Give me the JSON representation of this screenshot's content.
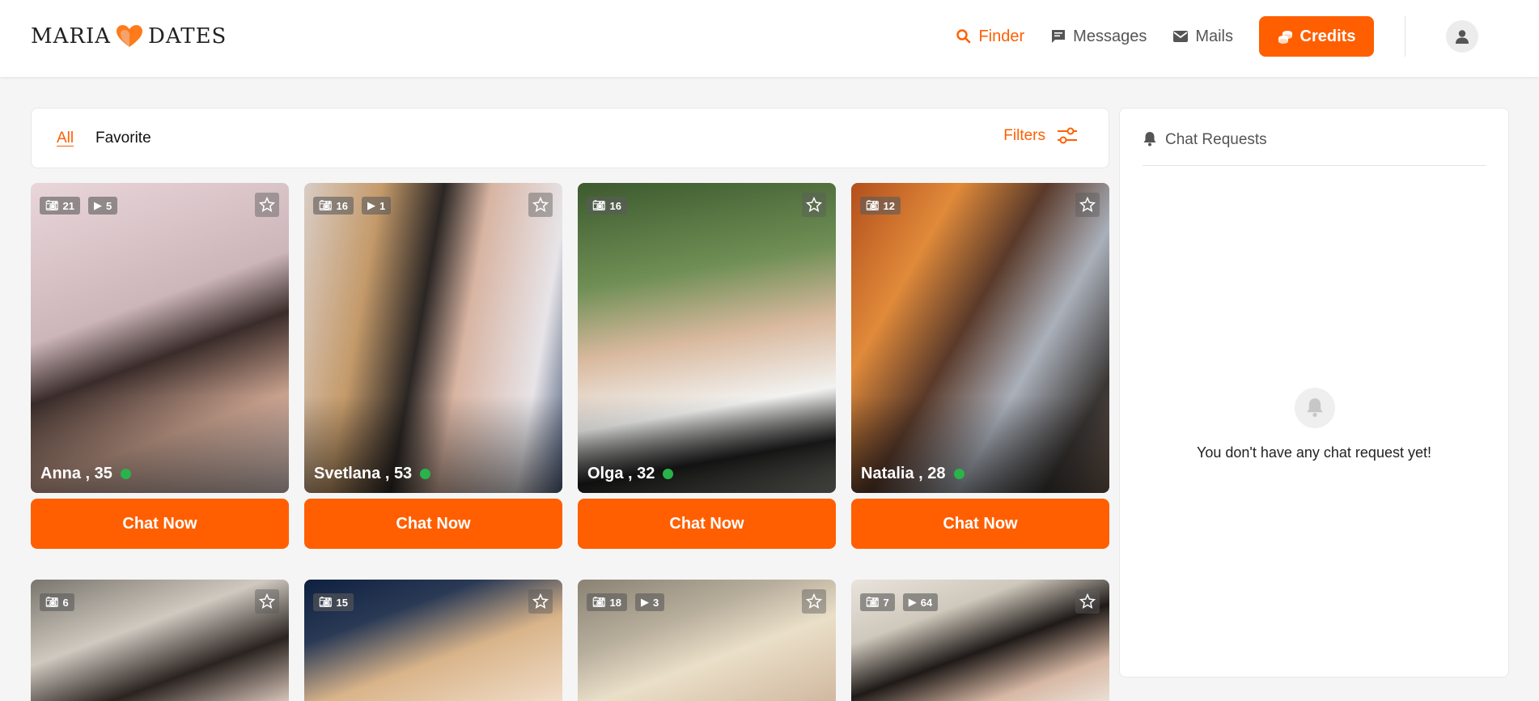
{
  "brand": {
    "left": "MARIA",
    "right": "DATES",
    "accent": "#ff5f00"
  },
  "nav": {
    "finder": "Finder",
    "messages": "Messages",
    "mails": "Mails",
    "credits": "Credits"
  },
  "tabs": {
    "all": "All",
    "favorite": "Favorite",
    "filters": "Filters"
  },
  "cards": [
    {
      "name": "Anna",
      "age": "35",
      "photos": "21",
      "videos": "5",
      "online": true,
      "cta": "Chat Now"
    },
    {
      "name": "Svetlana",
      "age": "53",
      "photos": "16",
      "videos": "1",
      "online": true,
      "cta": "Chat Now"
    },
    {
      "name": "Olga",
      "age": "32",
      "photos": "16",
      "videos": "",
      "online": true,
      "cta": "Chat Now"
    },
    {
      "name": "Natalia",
      "age": "28",
      "photos": "12",
      "videos": "",
      "online": true,
      "cta": "Chat Now"
    },
    {
      "photos": "6",
      "videos": ""
    },
    {
      "photos": "15",
      "videos": ""
    },
    {
      "photos": "18",
      "videos": "3"
    },
    {
      "photos": "7",
      "videos": "64"
    }
  ],
  "chat_requests": {
    "title": "Chat Requests",
    "empty": "You don't have any chat request yet!"
  }
}
